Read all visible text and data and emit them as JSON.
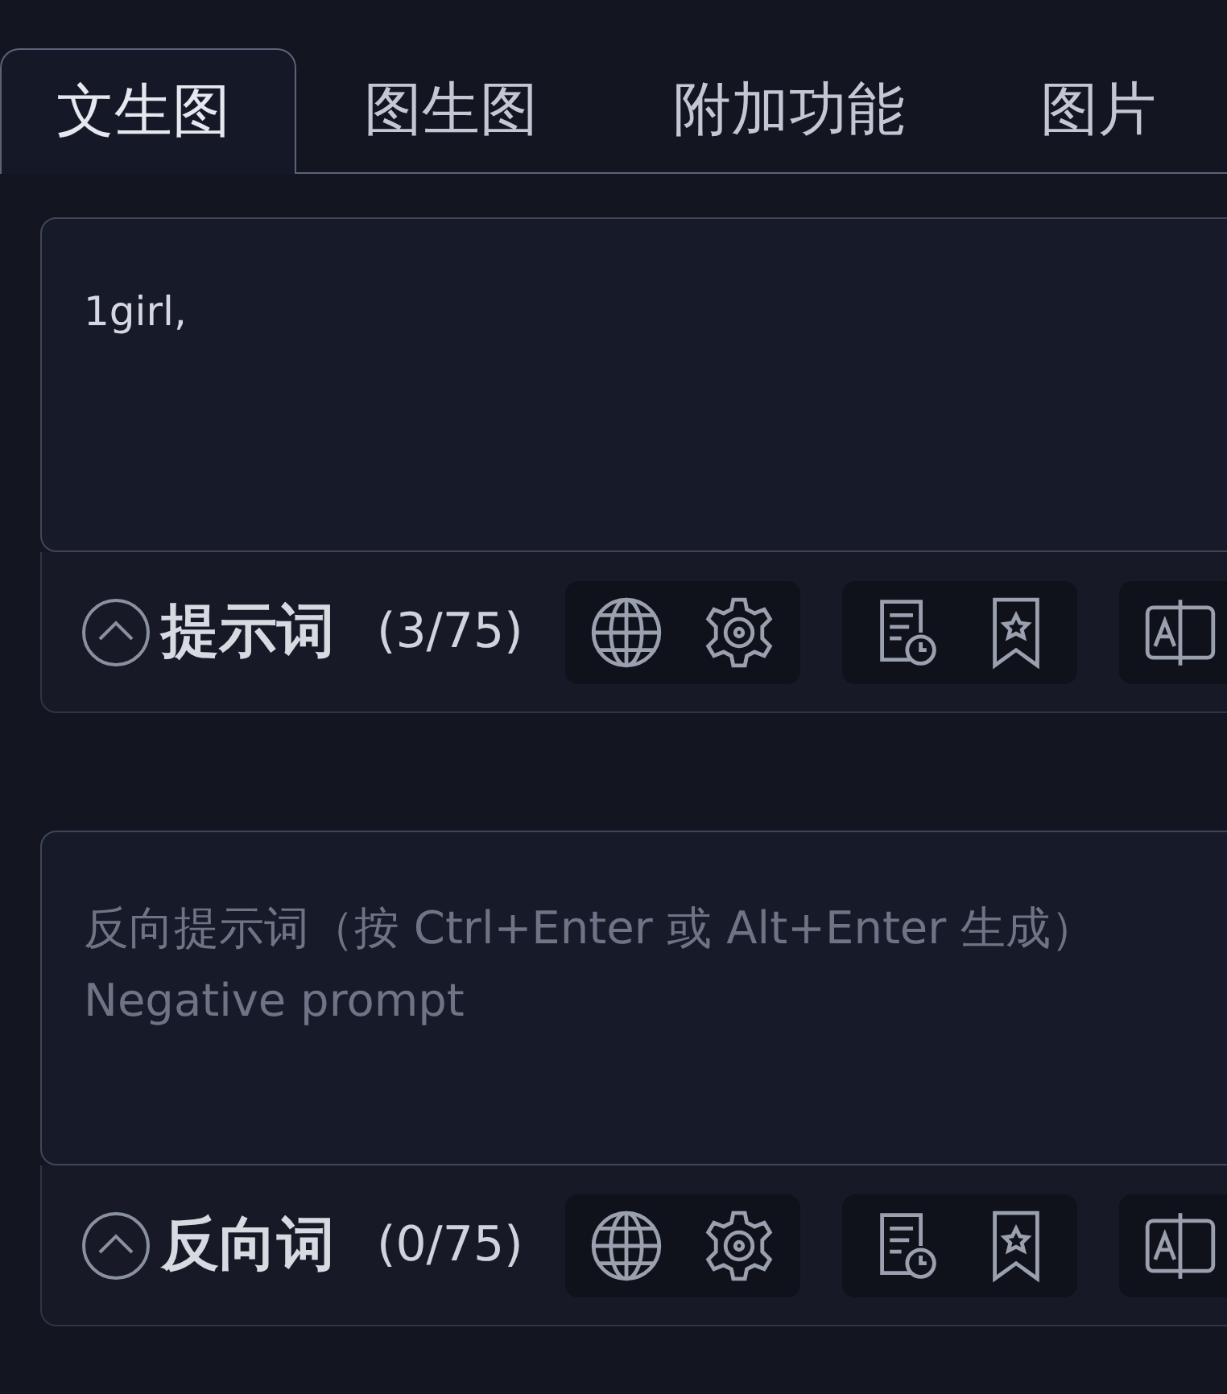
{
  "tabs": [
    {
      "label": "文生图",
      "selected": true
    },
    {
      "label": "图生图",
      "selected": false
    },
    {
      "label": "附加功能",
      "selected": false
    },
    {
      "label": "图片",
      "selected": false
    }
  ],
  "prompts": [
    {
      "value": "1girl,",
      "label": "提示词",
      "count": "(3/75)"
    },
    {
      "placeholder": "反向提示词（按 Ctrl+Enter 或 Alt+Enter 生成）\nNegative prompt",
      "label": "反向词",
      "count": "(0/75)"
    }
  ]
}
